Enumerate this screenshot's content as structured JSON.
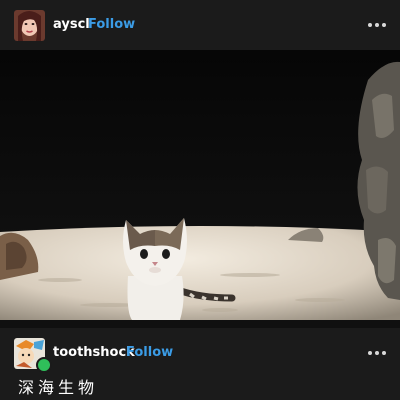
{
  "post1": {
    "username": "ayscl",
    "follow_label": "Follow"
  },
  "post2": {
    "username": "toothshock",
    "follow_label": "Follow",
    "caption": "深海生物"
  },
  "icons": {
    "more": "more-horizontal-icon",
    "badge": "verified-badge-icon"
  },
  "colors": {
    "background": "#1b1b1b",
    "follow": "#3b9ce6",
    "text": "#ffffff",
    "badge": "#2fbf5a"
  }
}
